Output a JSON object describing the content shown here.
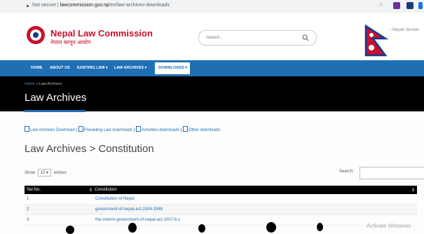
{
  "browser": {
    "security": "Not secure",
    "url_host": "lawcommission.gov.np",
    "url_path": "/en/law-archives-downloads"
  },
  "header": {
    "title": "Nepal Law Commission",
    "subtitle": "नेपाल कानून आयोग",
    "search_placeholder": "Search...",
    "version_link": "Nepali Version"
  },
  "nav": {
    "items": [
      "HOME",
      "ABOUT US",
      "EXISTING LAW ▾",
      "LAW ARCHIVES ▾"
    ],
    "active": "DOWNLOADS ▾"
  },
  "banner": {
    "breadcrumb_home": "Home",
    "breadcrumb_sep": "»",
    "breadcrumb_current": "Law Archives",
    "title": "Law Archives"
  },
  "downloads_links": [
    "Law Archives Download",
    "Prevailing Law downloads",
    "Activities downloads",
    "Other downloads"
  ],
  "section_title": "Law Archives > Constitution",
  "table_controls": {
    "show_label": "Show",
    "entries_value": "10",
    "entries_label": "entries",
    "search_label": "Search:"
  },
  "table": {
    "headers": [
      "Ser.No.",
      "Constitution"
    ],
    "sort_glyph": "⇕",
    "rows": [
      {
        "no": "1",
        "title": "Constitution of Nepal"
      },
      {
        "no": "2",
        "title": "government-of-nepal-act-2004-1948"
      },
      {
        "no": "3",
        "title": "the-interim-government-of-nepal-act-2007-b.s"
      }
    ]
  },
  "watermark": "Activate Windows",
  "colors": {
    "brand_red": "#c8102e",
    "nav_blue": "#1f6fb5",
    "banner_black": "#000000"
  }
}
